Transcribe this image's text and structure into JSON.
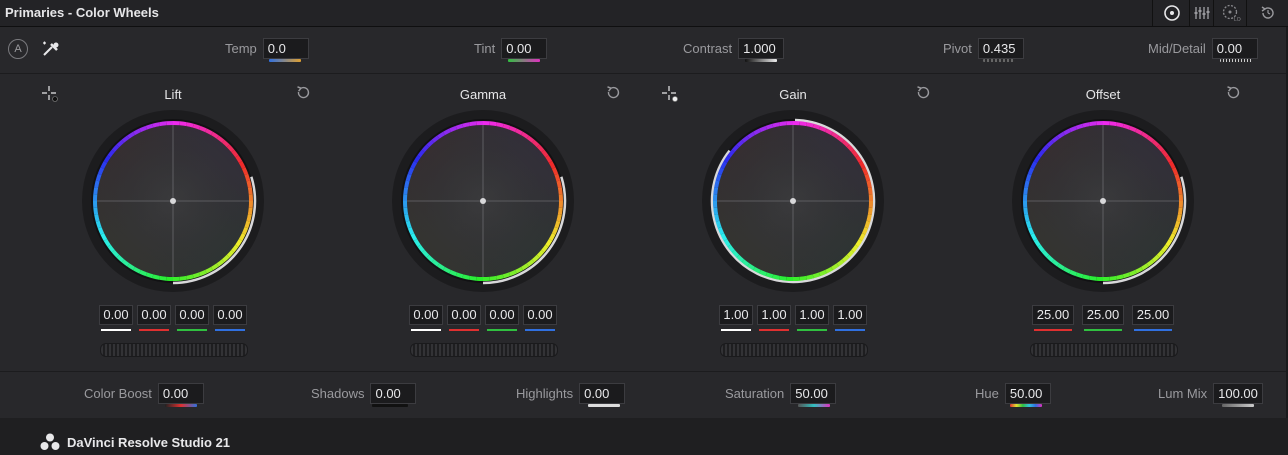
{
  "titlebar": {
    "title": "Primaries - Color Wheels"
  },
  "toolbar_icons": [
    "wheel-mode-icon",
    "bars-mode-icon",
    "log-mode-icon",
    "reset-all-icon"
  ],
  "top_params": {
    "auto_label": "A",
    "temp": {
      "label": "Temp",
      "value": "0.0"
    },
    "tint": {
      "label": "Tint",
      "value": "0.00"
    },
    "contrast": {
      "label": "Contrast",
      "value": "1.000"
    },
    "pivot": {
      "label": "Pivot",
      "value": "0.435"
    },
    "mid_detail": {
      "label": "Mid/Detail",
      "value": "0.00"
    }
  },
  "wheels": [
    {
      "name": "Lift",
      "values": [
        "0.00",
        "0.00",
        "0.00",
        "0.00"
      ]
    },
    {
      "name": "Gamma",
      "values": [
        "0.00",
        "0.00",
        "0.00",
        "0.00"
      ]
    },
    {
      "name": "Gain",
      "values": [
        "1.00",
        "1.00",
        "1.00",
        "1.00"
      ]
    },
    {
      "name": "Offset",
      "values": [
        "25.00",
        "25.00",
        "25.00"
      ]
    }
  ],
  "bottom_params": {
    "color_boost": {
      "label": "Color Boost",
      "value": "0.00"
    },
    "shadows": {
      "label": "Shadows",
      "value": "0.00"
    },
    "highlights": {
      "label": "Highlights",
      "value": "0.00"
    },
    "saturation": {
      "label": "Saturation",
      "value": "50.00"
    },
    "hue": {
      "label": "Hue",
      "value": "50.00"
    },
    "lum_mix": {
      "label": "Lum Mix",
      "value": "100.00"
    }
  },
  "footer": {
    "brand": "DaVinci Resolve Studio 21"
  },
  "colors": {
    "y": "#ffffff",
    "r": "#e03030",
    "g": "#30c040",
    "b": "#3070e0"
  }
}
